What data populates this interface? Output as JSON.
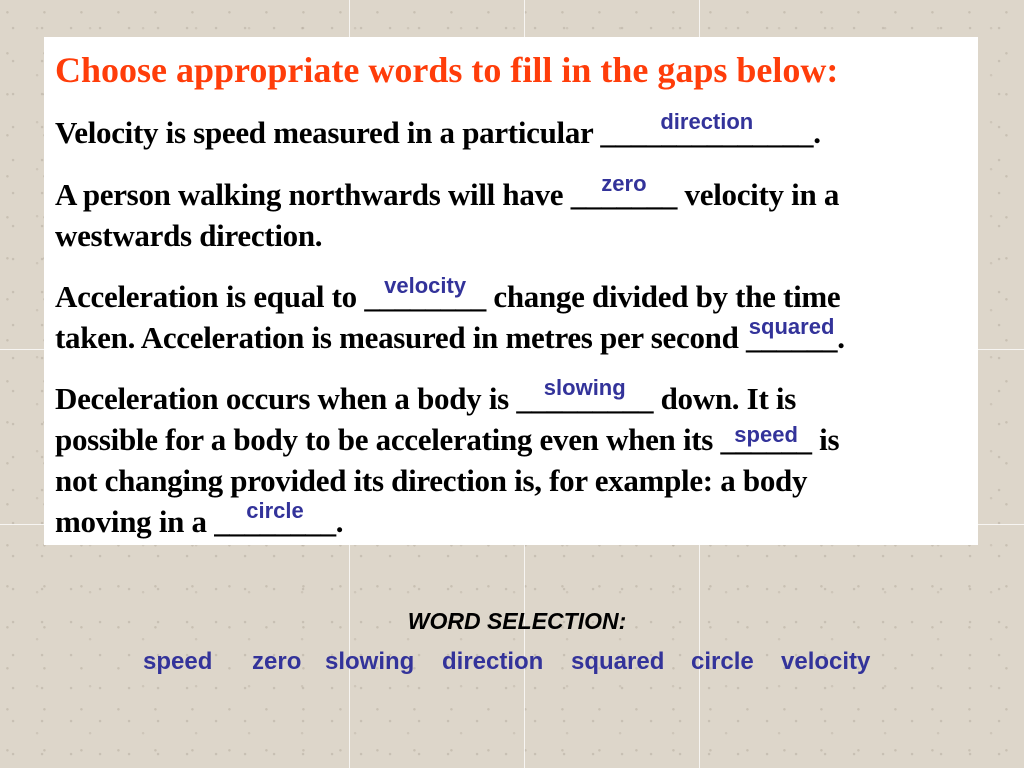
{
  "title": "Choose appropriate words to fill in the gaps below:",
  "sentences": {
    "s1": {
      "before": "Velocity is speed measured in a particular ",
      "blank": "______________",
      "answer": "direction",
      "after": "."
    },
    "s2": {
      "before": "A person walking northwards will have ",
      "blank": "_______",
      "answer": "zero",
      "after": " velocity in a",
      "line2": "westwards direction."
    },
    "s3": {
      "before": "Acceleration is equal to ",
      "blank": "________",
      "answer": "velocity",
      "after": " change divided by the time",
      "line2_before": "taken. Acceleration is measured in metres per second ",
      "blank2": "______",
      "answer2": "squared",
      "line2_after": "."
    },
    "s4": {
      "before": "Deceleration occurs when a body is ",
      "blank": "_________",
      "answer": "slowing",
      "after": " down.  It is",
      "line2_before": "possible for a body to be accelerating even when its ",
      "blank2": "______",
      "answer2": "speed",
      "line2_after": " is",
      "line3": "not changing provided its direction is, for example: a body",
      "line4_before": "moving in a ",
      "blank3": "________",
      "answer3": "circle",
      "line4_after": "."
    }
  },
  "word_selection": {
    "title": "WORD SELECTION:",
    "words": [
      "speed",
      "zero",
      "slowing",
      "direction",
      "squared",
      "circle",
      "velocity"
    ]
  },
  "colors": {
    "title": "#ff3d0a",
    "answer": "#33339a",
    "background": "#ddd6ca"
  }
}
